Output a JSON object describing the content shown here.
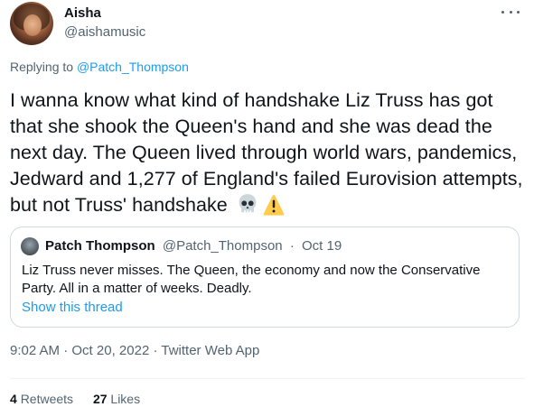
{
  "author": {
    "name": "Aisha",
    "handle": "@aishamusic"
  },
  "reply": {
    "prefix": "Replying to ",
    "to": "@Patch_Thompson"
  },
  "tweet": {
    "text": "I wanna know what kind of handshake Liz Truss has got that she shook the Queen's hand and she was dead the next day. The Queen lived through world wars, pandemics, Jedward and 1,277 of England's failed Eurovision attempts, but not Truss' handshake",
    "emojis": [
      "skull-emoji",
      "warning-emoji"
    ]
  },
  "quote": {
    "name": "Patch Thompson",
    "handle": "@Patch_Thompson",
    "separator": "·",
    "date": "Oct 19",
    "text": "Liz Truss never misses. The Queen, the economy and now the Conservative Party. All in a matter of weeks. Deadly.",
    "show_thread": "Show this thread"
  },
  "meta": {
    "time": "9:02 AM",
    "sep1": "·",
    "date": "Oct 20, 2022",
    "sep2": "·",
    "source": "Twitter Web App"
  },
  "stats": {
    "retweets_count": "4",
    "retweets_label": "Retweets",
    "likes_count": "27",
    "likes_label": "Likes"
  },
  "colors": {
    "link": "#1d9bf0",
    "secondary_text": "#536471",
    "border": "#cfd9de"
  }
}
